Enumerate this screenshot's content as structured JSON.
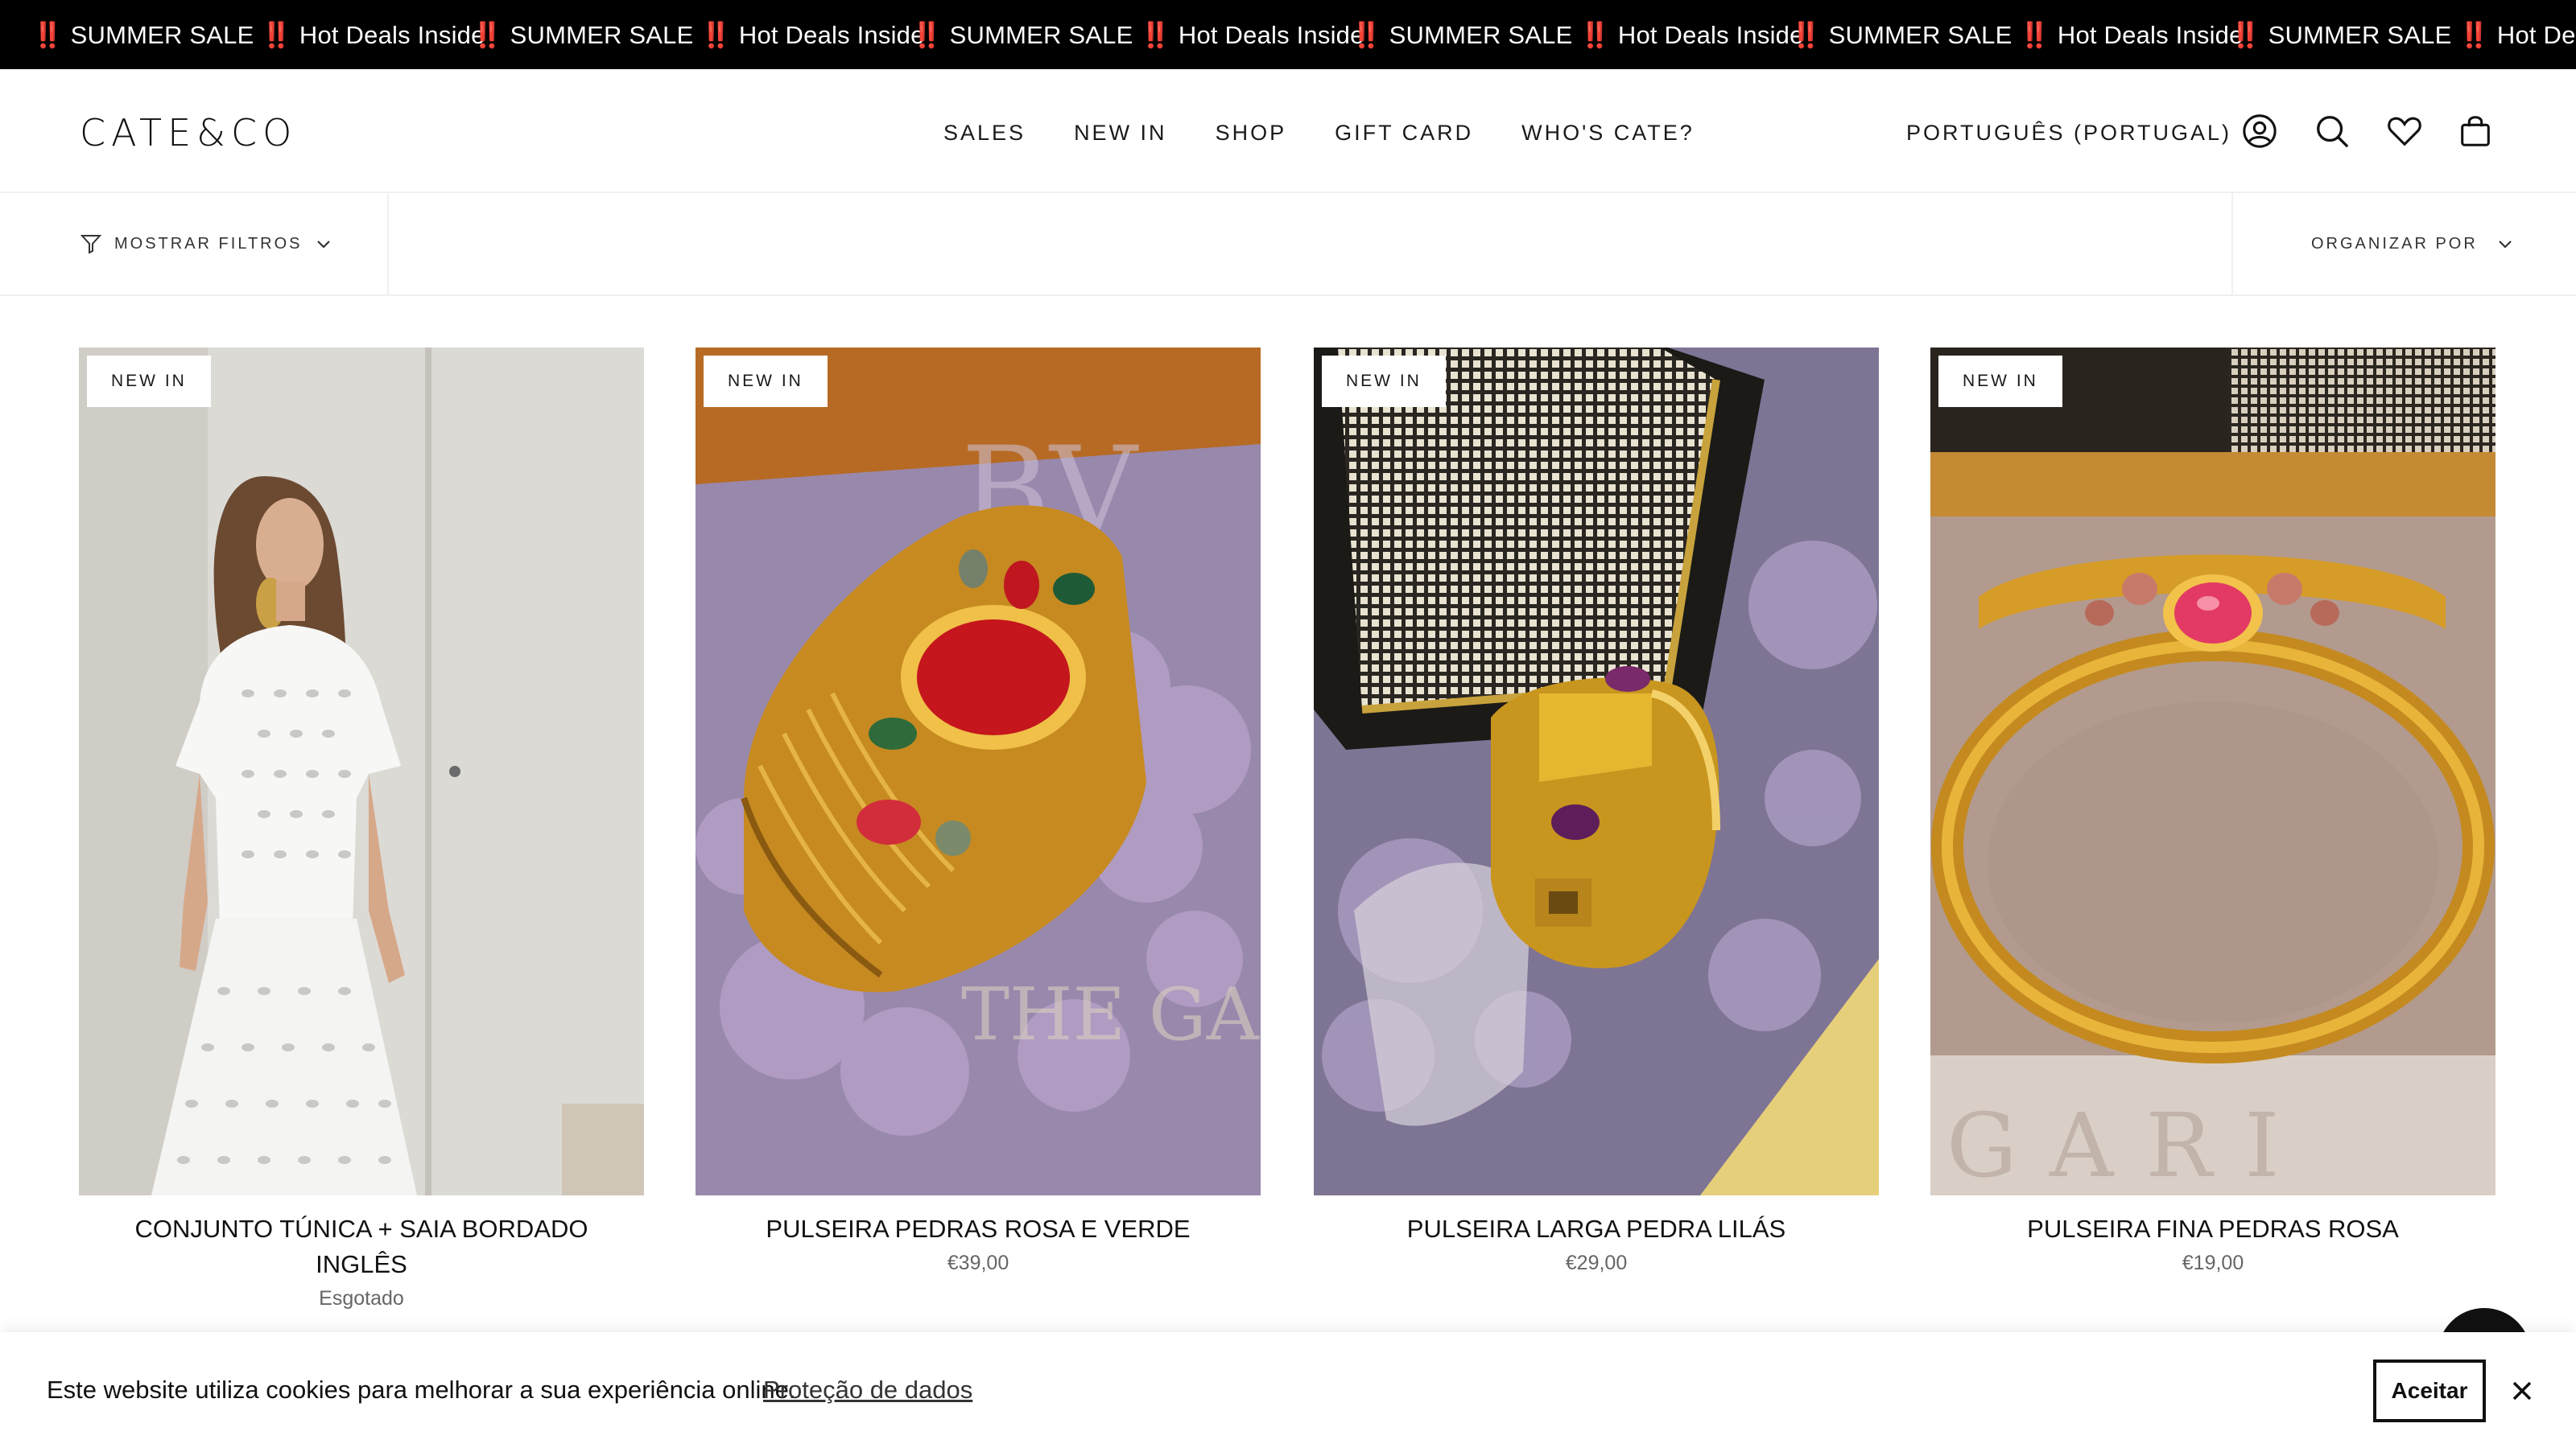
{
  "announcement": {
    "items": [
      "‼️ SUMMER SALE ‼️ Hot Deals Inside",
      "‼️ SUMMER SALE ‼️ Hot Deals Inside",
      "‼️ SUMMER SALE ‼️ Hot Deals Inside",
      "‼️ SUMMER SALE ‼️ Hot Deals Inside",
      "‼️ SUMMER SALE ‼️ Hot Deals Inside",
      "‼️ SUMMER SALE ‼️ Hot Deals Inside"
    ]
  },
  "header": {
    "logo": "CATE&CO",
    "nav": [
      "SALES",
      "NEW IN",
      "SHOP",
      "GIFT CARD",
      "WHO'S CATE?"
    ],
    "language": "PORTUGUÊS (PORTUGAL)",
    "icons": [
      "account-icon",
      "search-icon",
      "heart-icon",
      "bag-icon"
    ]
  },
  "filters": {
    "show_filters": "MOSTRAR FILTROS",
    "sort_by": "ORGANIZAR POR"
  },
  "products": [
    {
      "badge": "NEW IN",
      "title": "CONJUNTO TÚNICA + SAIA BORDADO INGLÊS",
      "price": "Esgotado"
    },
    {
      "badge": "NEW IN",
      "title": "PULSEIRA PEDRAS ROSA E VERDE",
      "price": "€39,00"
    },
    {
      "badge": "NEW IN",
      "title": "PULSEIRA LARGA PEDRA LILÁS",
      "price": "€29,00"
    },
    {
      "badge": "NEW IN",
      "title": "PULSEIRA FINA PEDRAS ROSA",
      "price": "€19,00"
    }
  ],
  "cookie": {
    "text": "Este website utiliza cookies para melhorar a sua experiência online.",
    "link": "Proteção de dados",
    "accept": "Aceitar"
  },
  "colors": {
    "announcement_bg": "#000000",
    "text": "#1a1a1a",
    "price": "#666666"
  }
}
